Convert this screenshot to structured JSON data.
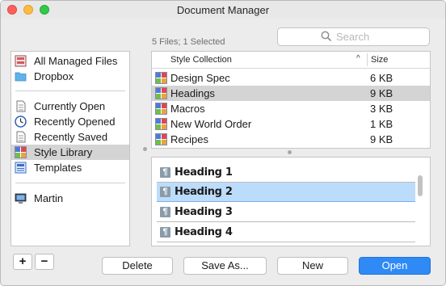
{
  "window": {
    "title": "Document Manager"
  },
  "sidebar": {
    "items": [
      {
        "label": "All Managed Files"
      },
      {
        "label": "Dropbox"
      },
      {
        "label": "Currently Open"
      },
      {
        "label": "Recently Opened"
      },
      {
        "label": "Recently Saved"
      },
      {
        "label": "Style Library"
      },
      {
        "label": "Templates"
      },
      {
        "label": "Martin"
      }
    ],
    "selected": "Style Library",
    "add_label": "+",
    "remove_label": "−"
  },
  "status": "5 Files; 1 Selected",
  "search": {
    "placeholder": "Search"
  },
  "file_table": {
    "columns": [
      "Style Collection",
      "Size"
    ],
    "rows": [
      {
        "name": "Design Spec",
        "size": "6 KB"
      },
      {
        "name": "Headings",
        "size": "9 KB"
      },
      {
        "name": "Macros",
        "size": "3 KB"
      },
      {
        "name": "New World Order",
        "size": "1 KB"
      },
      {
        "name": "Recipes",
        "size": "9 KB"
      }
    ],
    "selected": "Headings"
  },
  "styles": {
    "items": [
      {
        "name": "Heading 1"
      },
      {
        "name": "Heading 2"
      },
      {
        "name": "Heading 3"
      },
      {
        "name": "Heading 4"
      }
    ],
    "selected": "Heading 2"
  },
  "buttons": {
    "delete": "Delete",
    "save_as": "Save As...",
    "new": "New",
    "open": "Open"
  },
  "colors": {
    "accent": "#2f8af5",
    "selection_blue": "#bcdcfb",
    "selection_gray": "#d4d4d4"
  }
}
